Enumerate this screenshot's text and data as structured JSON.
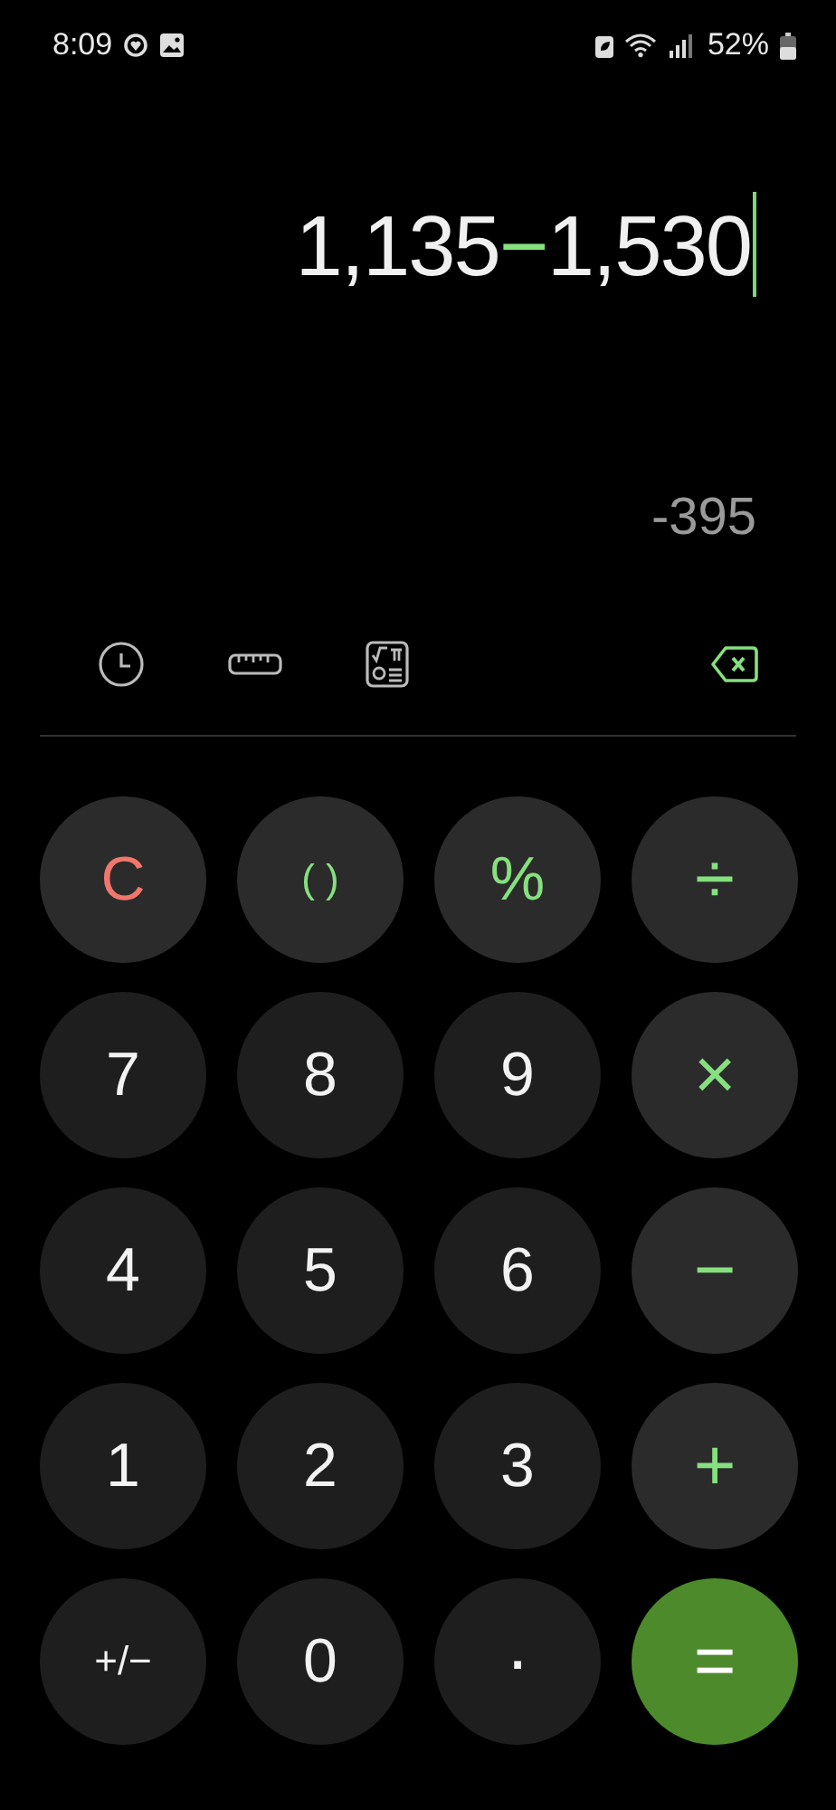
{
  "status_bar": {
    "time": "8:09",
    "battery": "52%"
  },
  "display": {
    "expression": [
      {
        "kind": "number",
        "text": "1,135"
      },
      {
        "kind": "operator",
        "text": "−"
      },
      {
        "kind": "number",
        "text": "1,530"
      }
    ],
    "result": "-395"
  },
  "keys": [
    {
      "kind": "clear",
      "label": "C"
    },
    {
      "kind": "function",
      "label": "( )"
    },
    {
      "kind": "function",
      "label": "%"
    },
    {
      "kind": "operator",
      "label": "÷"
    },
    {
      "kind": "digit",
      "label": "7"
    },
    {
      "kind": "digit",
      "label": "8"
    },
    {
      "kind": "digit",
      "label": "9"
    },
    {
      "kind": "operator",
      "label": "×"
    },
    {
      "kind": "digit",
      "label": "4"
    },
    {
      "kind": "digit",
      "label": "5"
    },
    {
      "kind": "digit",
      "label": "6"
    },
    {
      "kind": "operator",
      "label": "−"
    },
    {
      "kind": "digit",
      "label": "1"
    },
    {
      "kind": "digit",
      "label": "2"
    },
    {
      "kind": "digit",
      "label": "3"
    },
    {
      "kind": "operator",
      "label": "+"
    },
    {
      "kind": "digit",
      "label": "+/−"
    },
    {
      "kind": "digit",
      "label": "0"
    },
    {
      "kind": "decimal",
      "label": "."
    },
    {
      "kind": "equals",
      "label": "="
    }
  ]
}
